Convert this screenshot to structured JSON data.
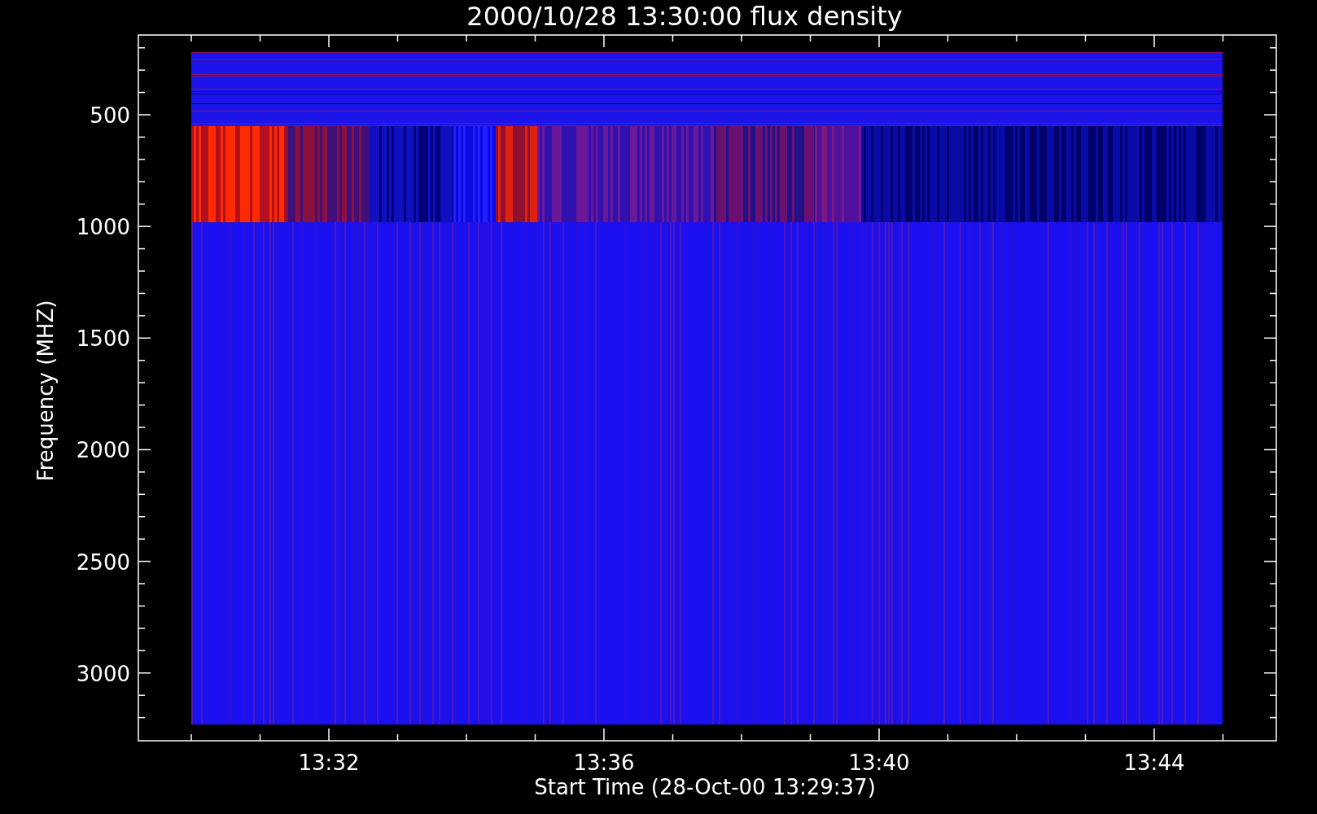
{
  "plot": {
    "title": "2000/10/28 13:30:00 flux density",
    "xlabel": "Start Time (28-Oct-00 13:29:37)",
    "ylabel": "Frequency (MHZ)",
    "xtick_labels": [
      "13:32",
      "13:36",
      "13:40",
      "13:44"
    ],
    "ytick_labels": [
      "500",
      "1000",
      "1500",
      "2000",
      "2500",
      "3000"
    ]
  }
}
